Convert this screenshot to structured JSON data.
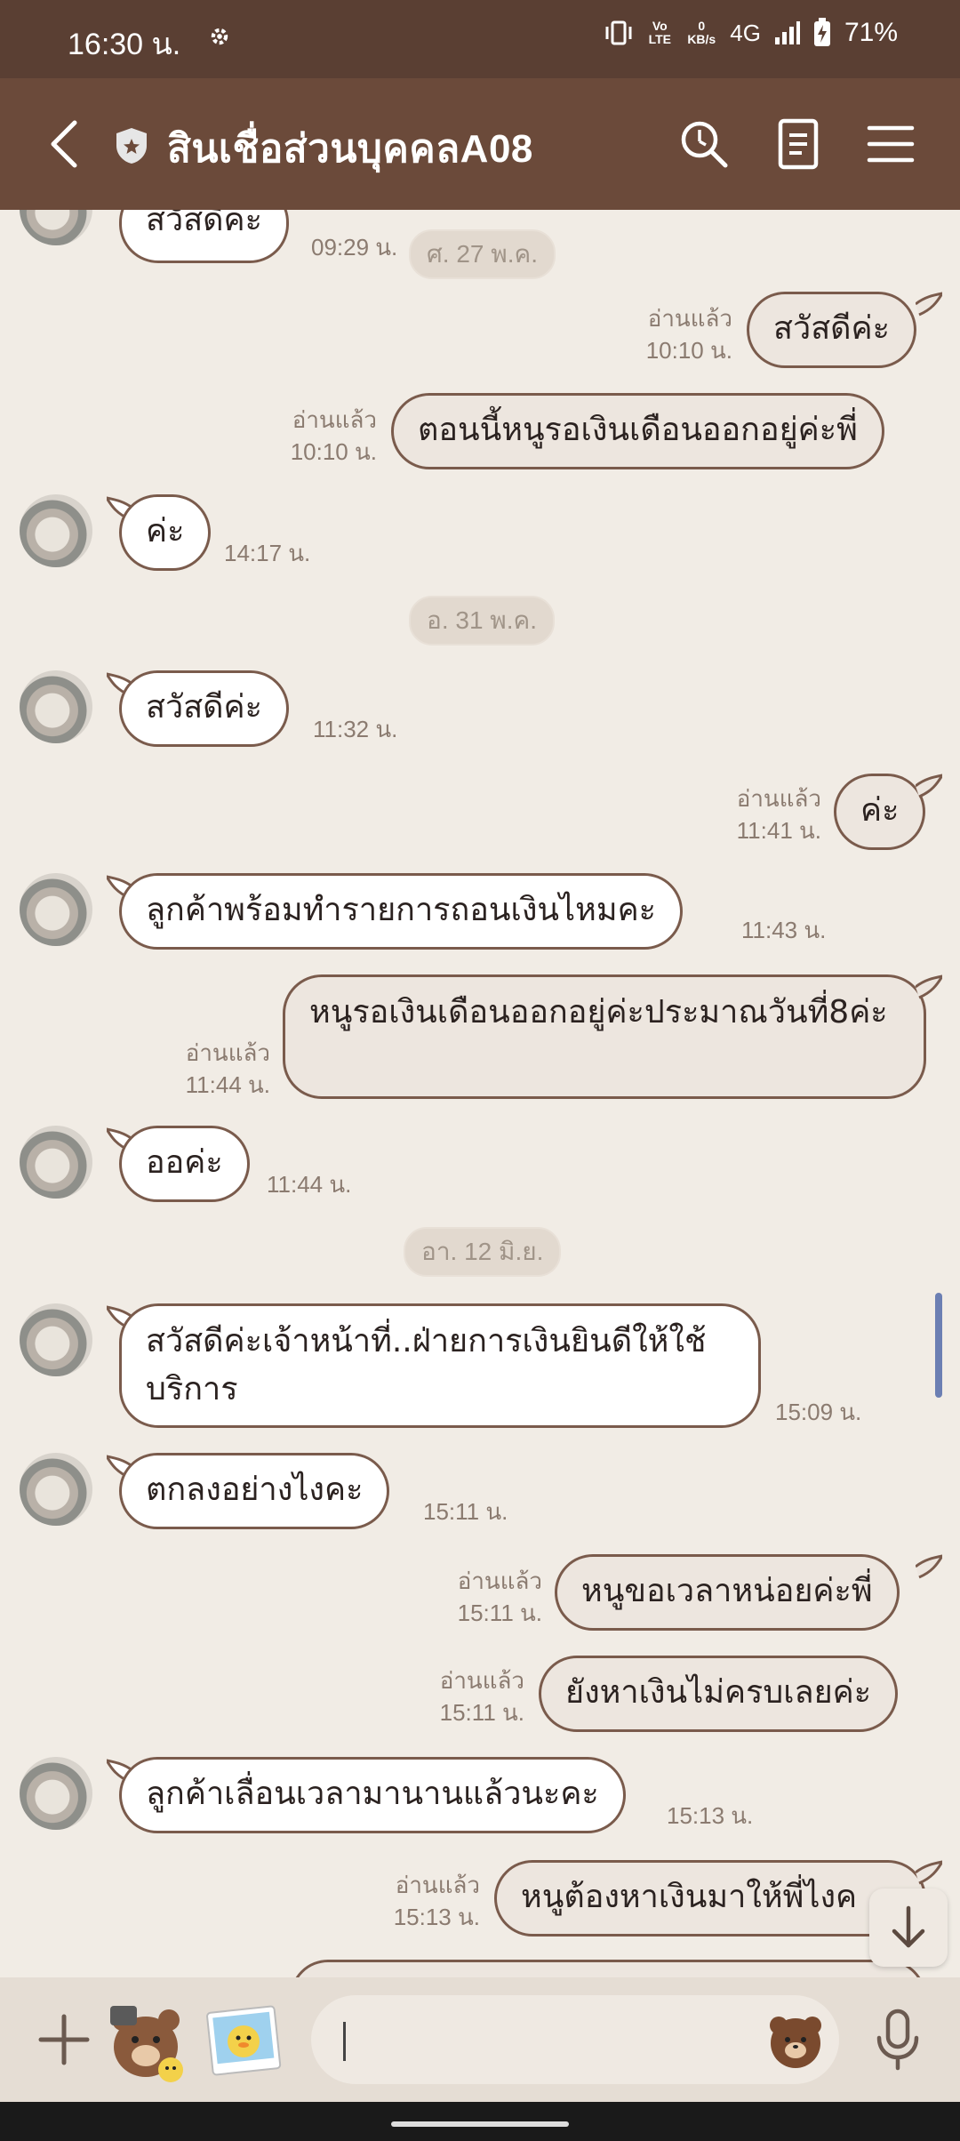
{
  "status": {
    "time": "16:30 น.",
    "volte": "Vo LTE",
    "net_speed": "0 KB/s",
    "network": "4G",
    "battery": "71%"
  },
  "header": {
    "title": "สินเชื่อส่วนบุคคลA08"
  },
  "chat": {
    "date_chips": [
      "ศ. 27 พ.ค.",
      "อ. 31 พ.ค.",
      "อา. 12 มิ.ย."
    ],
    "read_label": "อ่านแล้ว",
    "messages": [
      {
        "side": "in",
        "text": "สวัสดีค่ะ",
        "time": "09:29 น."
      },
      {
        "side": "out",
        "text": "สวัสดีค่ะ",
        "time": "10:10 น."
      },
      {
        "side": "out",
        "text": "ตอนนี้หนูรอเงินเดือนออกอยู่ค่ะพี่",
        "time": "10:10 น."
      },
      {
        "side": "in",
        "text": "ค่ะ",
        "time": "14:17 น."
      },
      {
        "side": "in",
        "text": "สวัสดีค่ะ",
        "time": "11:32 น."
      },
      {
        "side": "out",
        "text": "ค่ะ",
        "time": "11:41 น."
      },
      {
        "side": "in",
        "text": "ลูกค้าพร้อมทำรายการถอนเงินไหมคะ",
        "time": "11:43 น."
      },
      {
        "side": "out",
        "text": "หนูรอเงินเดือนออกอยู่ค่ะประมาณวันที่8ค่ะ",
        "time": "11:44 น."
      },
      {
        "side": "in",
        "text": "ออค่ะ",
        "time": "11:44 น."
      },
      {
        "side": "in",
        "text": "สวัสดีค่ะเจ้าหน้าที่..ฝ่ายการเงินยินดีให้ใช้บริการ",
        "time": "15:09 น."
      },
      {
        "side": "in",
        "text": "ตกลงอย่างไงคะ",
        "time": "15:11 น."
      },
      {
        "side": "out",
        "text": "หนูขอเวลาหน่อยค่ะพี่",
        "time": "15:11 น."
      },
      {
        "side": "out",
        "text": "ยังหาเงินไม่ครบเลยค่ะ",
        "time": "15:11 น."
      },
      {
        "side": "in",
        "text": "ลูกค้าเลื่อนเวลามานานแล้วนะคะ",
        "time": "15:13 น."
      },
      {
        "side": "out",
        "text": "หนูต้องหาเงินมาให้พี่ไงค",
        "time": "15:13 น."
      }
    ]
  },
  "input": {
    "value": "",
    "placeholder": ""
  },
  "colors": {
    "header": "#6b4a3a",
    "statusbar": "#5a3f33",
    "background": "#f1ece5",
    "bubble_border": "#7a5b4c",
    "scroll_indicator": "#6c7fb3"
  }
}
